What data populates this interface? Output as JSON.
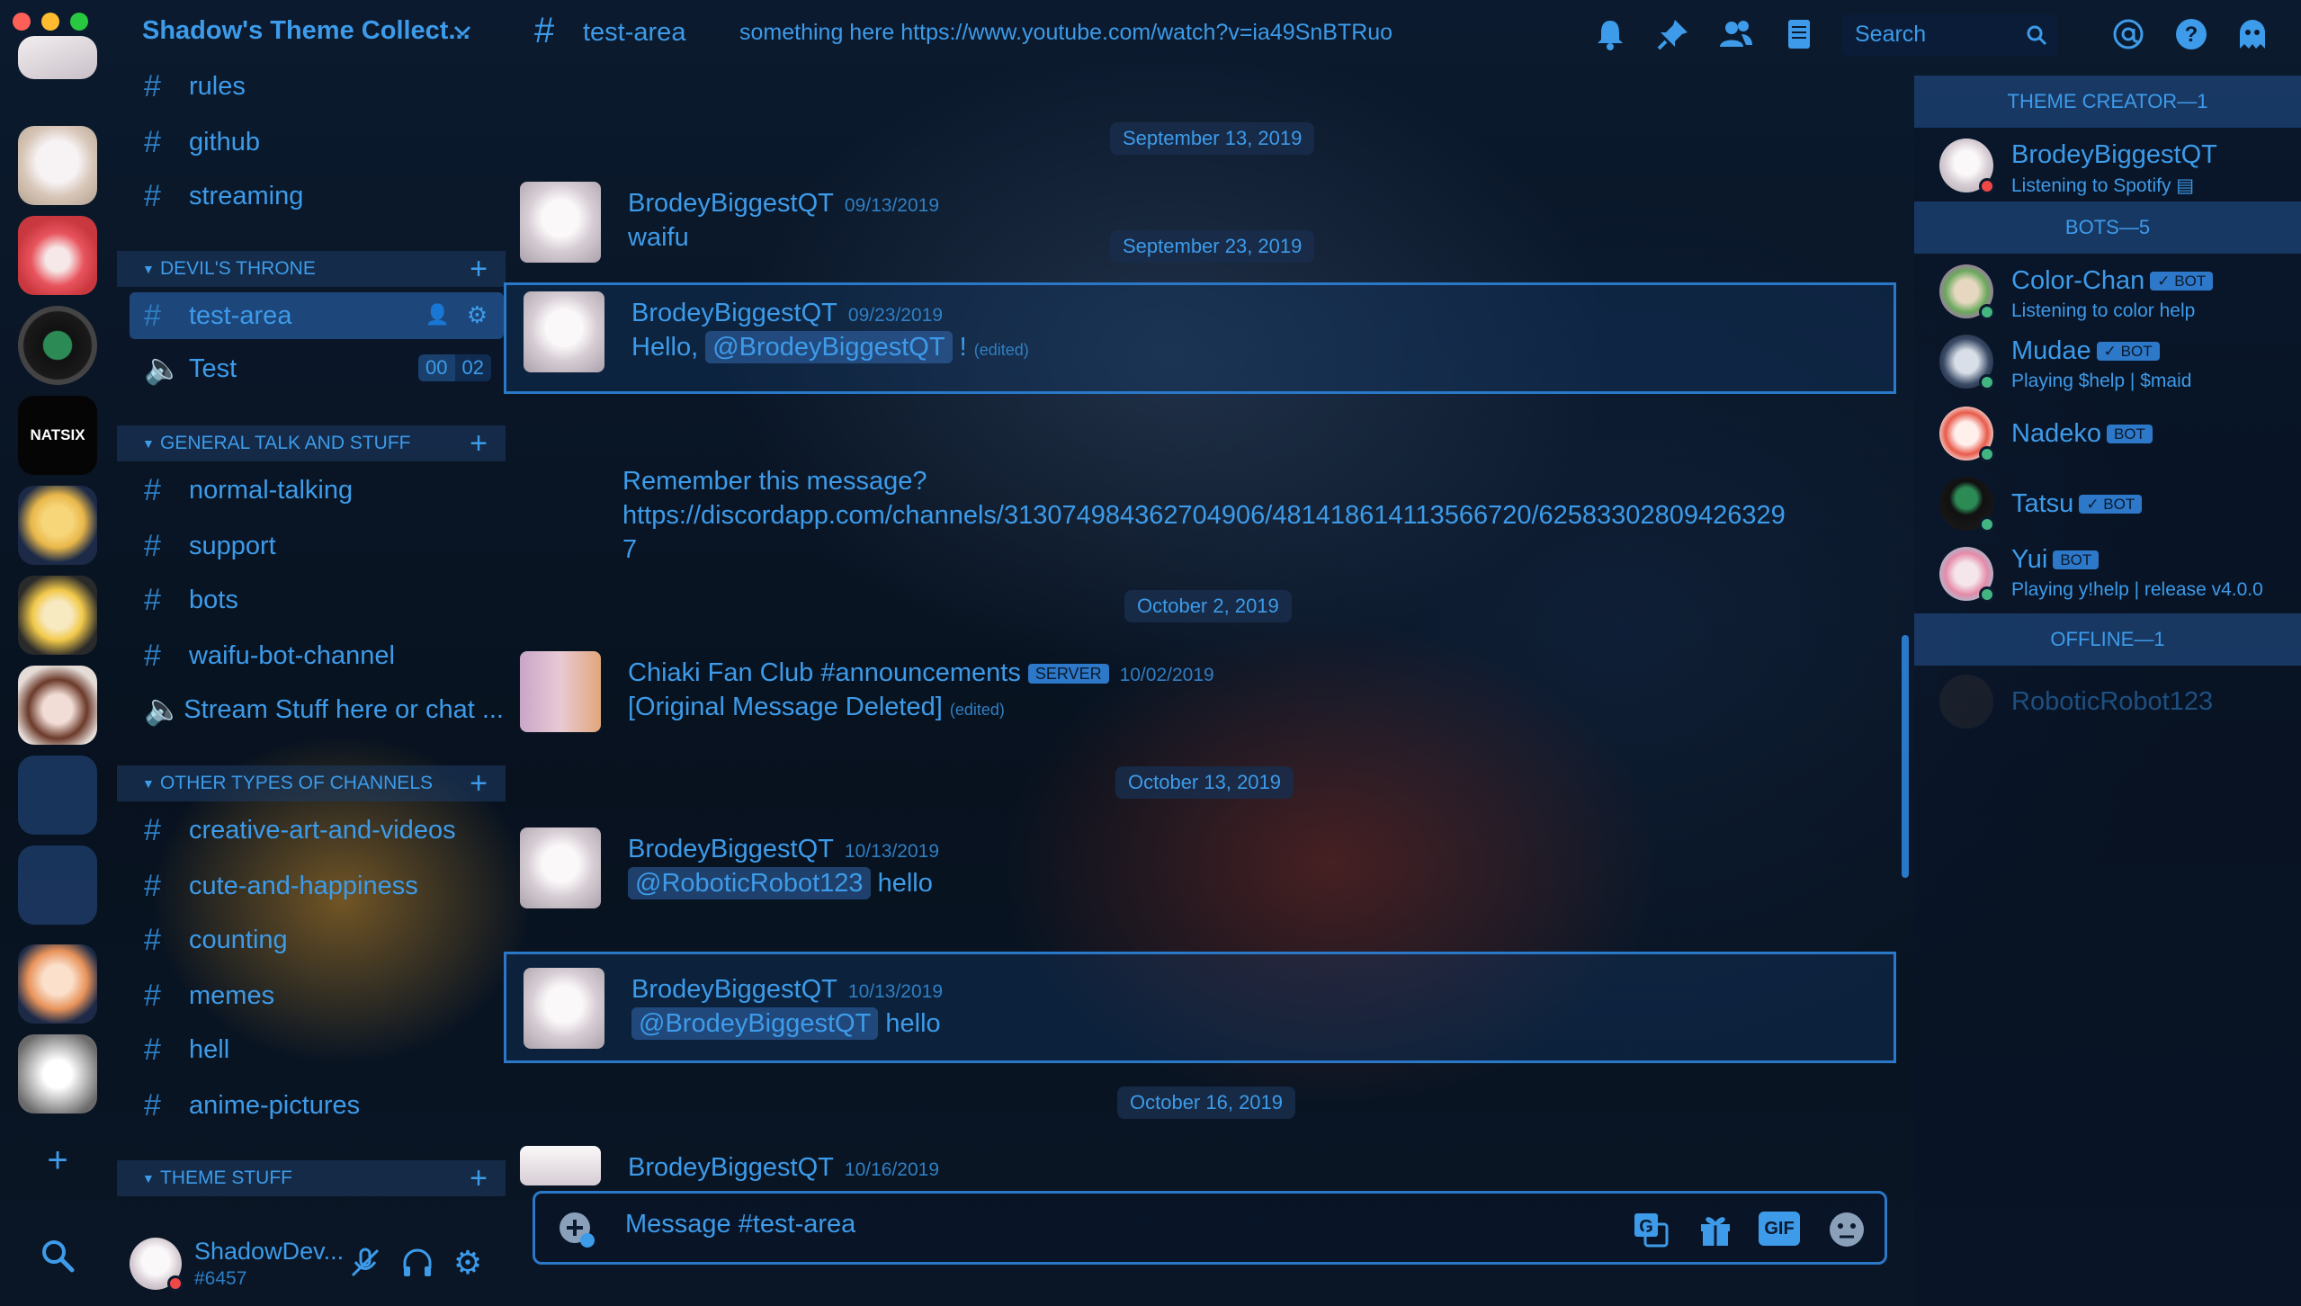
{
  "guild": {
    "name": "Shadow's Theme Collect..."
  },
  "channels": {
    "top": [
      {
        "name": "rules"
      },
      {
        "name": "github"
      },
      {
        "name": "streaming"
      }
    ],
    "categories": [
      {
        "name": "DEVIL'S THRONE"
      },
      {
        "name": "GENERAL TALK AND STUFF"
      },
      {
        "name": "OTHER TYPES OF CHANNELS"
      },
      {
        "name": "THEME STUFF"
      }
    ],
    "devils_throne": [
      {
        "name": "test-area"
      },
      {
        "name": "Test",
        "voice_a": "00",
        "voice_b": "02"
      }
    ],
    "general": [
      {
        "name": "normal-talking"
      },
      {
        "name": "support"
      },
      {
        "name": "bots"
      },
      {
        "name": "waifu-bot-channel"
      },
      {
        "name": "Stream Stuff here or chat ..."
      }
    ],
    "other": [
      {
        "name": "creative-art-and-videos"
      },
      {
        "name": "cute-and-happiness"
      },
      {
        "name": "counting"
      },
      {
        "name": "memes"
      },
      {
        "name": "hell"
      },
      {
        "name": "anime-pictures"
      }
    ]
  },
  "user": {
    "name": "ShadowDev...",
    "tag": "#6457"
  },
  "header": {
    "hash": "#",
    "channel": "test-area",
    "topic": "something here https://www.youtube.com/watch?v=ia49SnBTRuo",
    "search_placeholder": "Search"
  },
  "messages": {
    "dates": [
      "September 13, 2019",
      "September 23, 2019",
      "October 2, 2019",
      "October 13, 2019",
      "October 16, 2019"
    ],
    "m1": {
      "author": "BrodeyBiggestQT",
      "time": "09/13/2019",
      "text": "waifu"
    },
    "m2": {
      "author": "BrodeyBiggestQT",
      "time": "09/23/2019",
      "pre": "Hello,",
      "mention": "@BrodeyBiggestQT",
      "post": "!",
      "edited": "(edited)"
    },
    "m2b": {
      "line1": "Remember this message?",
      "line2": "https://discordapp.com/channels/313074984362704906/481418614113566720/62583302809426329",
      "line3": "7"
    },
    "m3": {
      "author": "Chiaki Fan Club #announcements",
      "badge": "SERVER",
      "time": "10/02/2019",
      "text": "[Original Message Deleted]",
      "edited": "(edited)"
    },
    "m4": {
      "author": "BrodeyBiggestQT",
      "time": "10/13/2019",
      "mention": "@RoboticRobot123",
      "text": "hello"
    },
    "m5": {
      "author": "BrodeyBiggestQT",
      "time": "10/13/2019",
      "mention": "@BrodeyBiggestQT",
      "text": "hello"
    },
    "m6": {
      "author": "BrodeyBiggestQT",
      "time": "10/16/2019"
    }
  },
  "composer": {
    "placeholder": "Message #test-area",
    "gif": "GIF"
  },
  "members": {
    "groups": [
      "THEME CREATOR—1",
      "BOTS—5",
      "OFFLINE—1"
    ],
    "creator": {
      "name": "BrodeyBiggestQT",
      "activity": "Listening to Spotify"
    },
    "bots": [
      {
        "name": "Color-Chan",
        "tag": "✓ BOT",
        "activity": "Listening to color help"
      },
      {
        "name": "Mudae",
        "tag": "✓ BOT",
        "activity": "Playing $help | $maid"
      },
      {
        "name": "Nadeko",
        "tag": "BOT",
        "activity": ""
      },
      {
        "name": "Tatsu",
        "tag": "✓ BOT",
        "activity": ""
      },
      {
        "name": "Yui",
        "tag": "BOT",
        "activity": "Playing y!help | release v4.0.0"
      }
    ],
    "offline": {
      "name": "RoboticRobot123"
    }
  },
  "colors": {
    "accent": "#3d9be9",
    "border": "#2a78c8",
    "online": "#43b581",
    "dnd": "#f04747"
  }
}
